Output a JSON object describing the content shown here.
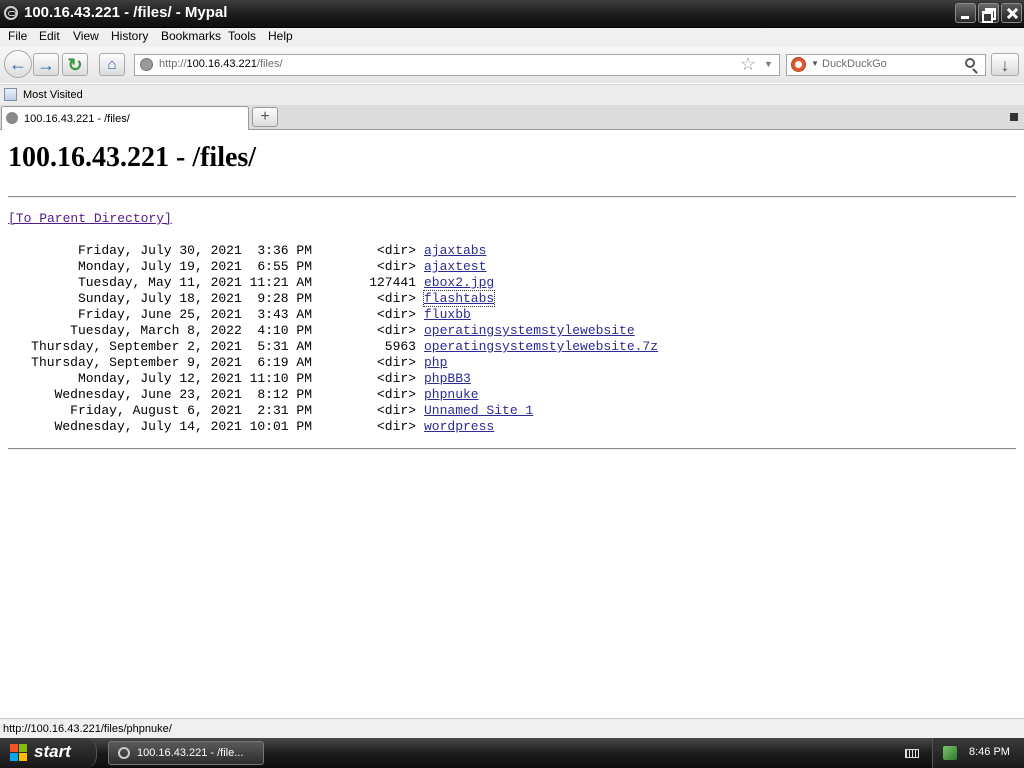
{
  "window": {
    "title": "100.16.43.221 - /files/ - Mypal"
  },
  "menu": [
    "File",
    "Edit",
    "View",
    "History",
    "Bookmarks",
    "Tools",
    "Help"
  ],
  "nav": {
    "url_prefix": "http://",
    "url_main": "100.16.43.221",
    "url_suffix": "/files/",
    "search_placeholder": "DuckDuckGo"
  },
  "bookmarks": {
    "most_visited": "Most Visited"
  },
  "tabs": [
    {
      "label": "100.16.43.221 - /files/"
    }
  ],
  "page": {
    "heading": "100.16.43.221 - /files/",
    "parent_link": "[To Parent Directory]",
    "entries": [
      {
        "date": "Friday, July 30, 2021  3:36 PM",
        "size": "<dir>",
        "name": "ajaxtabs"
      },
      {
        "date": "Monday, July 19, 2021  6:55 PM",
        "size": "<dir>",
        "name": "ajaxtest"
      },
      {
        "date": "Tuesday, May 11, 2021 11:21 AM",
        "size": "127441",
        "name": "ebox2.jpg"
      },
      {
        "date": "Sunday, July 18, 2021  9:28 PM",
        "size": "<dir>",
        "name": "flashtabs"
      },
      {
        "date": "Friday, June 25, 2021  3:43 AM",
        "size": "<dir>",
        "name": "fluxbb"
      },
      {
        "date": "Tuesday, March 8, 2022  4:10 PM",
        "size": "<dir>",
        "name": "operatingsystemstylewebsite"
      },
      {
        "date": "Thursday, September 2, 2021  5:31 AM",
        "size": "5963",
        "name": "operatingsystemstylewebsite.7z"
      },
      {
        "date": "Thursday, September 9, 2021  6:19 AM",
        "size": "<dir>",
        "name": "php"
      },
      {
        "date": "Monday, July 12, 2021 11:10 PM",
        "size": "<dir>",
        "name": "phpBB3"
      },
      {
        "date": "Wednesday, June 23, 2021  8:12 PM",
        "size": "<dir>",
        "name": "phpnuke"
      },
      {
        "date": "Friday, August 6, 2021  2:31 PM",
        "size": "<dir>",
        "name": "Unnamed Site 1"
      },
      {
        "date": "Wednesday, July 14, 2021 10:01 PM",
        "size": "<dir>",
        "name": "wordpress"
      }
    ]
  },
  "status": {
    "text": "http://100.16.43.221/files/phpnuke/"
  },
  "taskbar": {
    "start": "start",
    "task_label": "100.16.43.221 - /file...",
    "clock": "8:46 PM"
  }
}
